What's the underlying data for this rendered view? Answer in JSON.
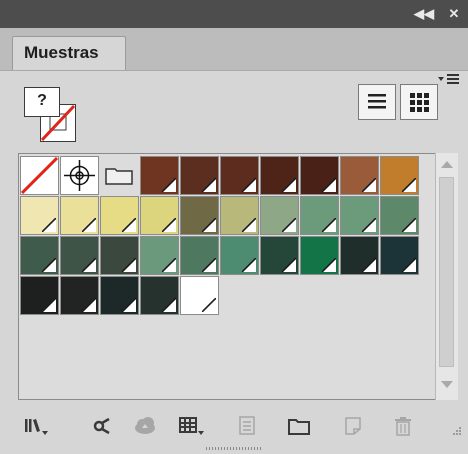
{
  "window": {
    "collapse_icon": "double-chevron-left-icon",
    "close_icon": "close-icon"
  },
  "panel": {
    "tab_label": "Muestras",
    "menu_icon": "panel-menu-icon",
    "fill_indicator": "?",
    "view_buttons": [
      "list-view-icon",
      "grid-view-icon"
    ]
  },
  "colors": {
    "panel_bg": "#d6d6d6",
    "none_red": "#e0241b",
    "swatches": [
      "none",
      "registration",
      "group",
      "#6f3521",
      "#5c2e1f",
      "#5e2c1e",
      "#4f2418",
      "#4a2116",
      "#9a5b3a",
      "#c17c2c",
      "#efe6b2",
      "#ebe09a",
      "#e6dc86",
      "#ddd57d",
      "#6f6a45",
      "#b7b879",
      "#8ea787",
      "#6b9b7a",
      "#6b9b7a",
      "#5d8869",
      "#3f5b4c",
      "#3d5446",
      "#3b483e",
      "#6a9a7b",
      "#4e7860",
      "#4d8c71",
      "#24473a",
      "#137447",
      "#1f2e2a",
      "#1c3337",
      "#1e2020",
      "#222423",
      "#1d2828",
      "#26322d",
      "#ffffff"
    ]
  },
  "footer": {
    "icons": [
      "swatch-libraries-menu-icon",
      "show-swatch-kinds-icon",
      "cc-libraries-icon",
      "swatch-options-icon",
      "new-color-group-icon",
      "new-folder-icon",
      "new-swatch-icon",
      "trash-icon"
    ]
  }
}
